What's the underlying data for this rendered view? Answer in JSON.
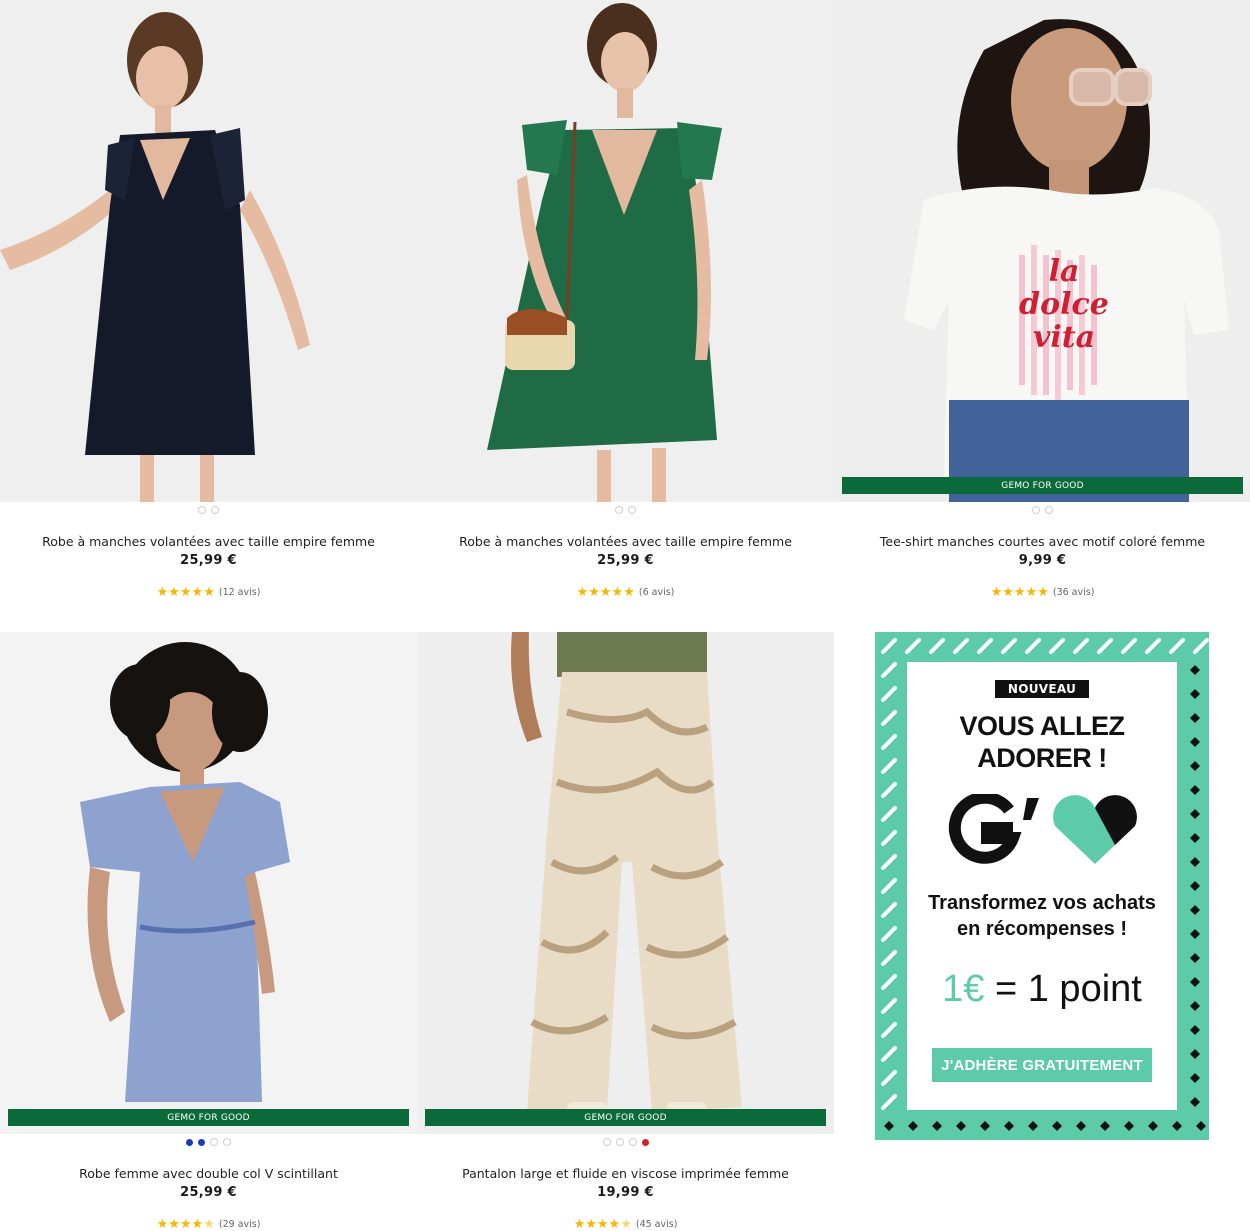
{
  "products": [
    {
      "title": "Robe à manches volantées avec taille empire femme",
      "price": "25,99 €",
      "stars": "★★★★★",
      "reviews": "(12 avis)",
      "rating": 5,
      "ribbon": "",
      "colors": [
        "#ffffff",
        "#ffffff"
      ],
      "garment_color": "#151a2a"
    },
    {
      "title": "Robe à manches volantées avec taille empire femme",
      "price": "25,99 €",
      "stars": "★★★★★",
      "reviews": "(6 avis)",
      "rating": 5,
      "ribbon": "",
      "colors": [
        "#ffffff",
        "#ffffff"
      ],
      "garment_color": "#1f6b45"
    },
    {
      "title": "Tee-shirt manches courtes avec motif coloré femme",
      "price": "9,99 €",
      "stars": "★★★★★",
      "reviews": "(36 avis)",
      "rating": 5,
      "ribbon": "GEMO FOR GOOD",
      "colors": [
        "#ffffff",
        "#ffffff"
      ],
      "garment_color": "#f7f7f5",
      "print_text": [
        "la",
        "dolce",
        "vita"
      ]
    },
    {
      "title": "Robe femme avec double col V scintillant",
      "price": "25,99 €",
      "stars": "★★★★",
      "half_star": "★",
      "reviews": "(29 avis)",
      "rating": 4.5,
      "ribbon": "GEMO FOR GOOD",
      "colors": [
        "#1d39b8",
        "#1d39b8",
        "#ffffff",
        "#ffffff"
      ],
      "garment_color": "#8ea2cf"
    },
    {
      "title": "Pantalon large et fluide en viscose imprimée femme",
      "price": "19,99 €",
      "stars": "★★★★",
      "half_star": "★",
      "reviews": "(45 avis)",
      "rating": 4.5,
      "ribbon": "GEMO FOR GOOD",
      "colors": [
        "#ffffff",
        "#ffffff",
        "#ffffff",
        "#d42020"
      ],
      "garment_color": "#e9dcc6"
    }
  ],
  "promo": {
    "badge": "NOUVEAU",
    "headline_1": "VOUS ALLEZ",
    "headline_2": "ADORER !",
    "subtitle_1": "Transformez vos achats",
    "subtitle_2": "en récompenses !",
    "points_eur": "1€",
    "points_rest": " = 1 point",
    "cta": "J'ADHÈRE GRATUITEMENT",
    "accent_color": "#5dcaa8"
  }
}
